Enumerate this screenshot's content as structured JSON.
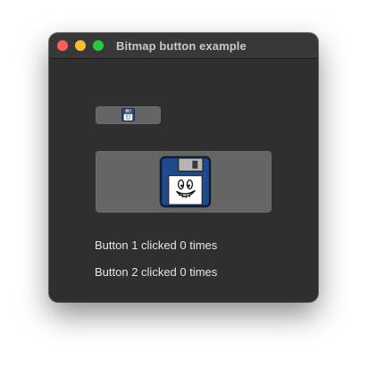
{
  "window": {
    "title": "Bitmap button example"
  },
  "buttons": [
    {
      "icon": "floppy-disk-icon",
      "size": "small"
    },
    {
      "icon": "floppy-disk-smiley-icon",
      "size": "large"
    }
  ],
  "labels": {
    "button1": "Button 1 clicked 0 times",
    "button2": "Button 2 clicked 0 times"
  },
  "colors": {
    "window_bg": "#2f2f2f",
    "button_bg": "#656565",
    "floppy_blue": "#1f4a8c",
    "close": "#ff5f57",
    "minimize": "#febc2e",
    "zoom": "#28c840"
  }
}
